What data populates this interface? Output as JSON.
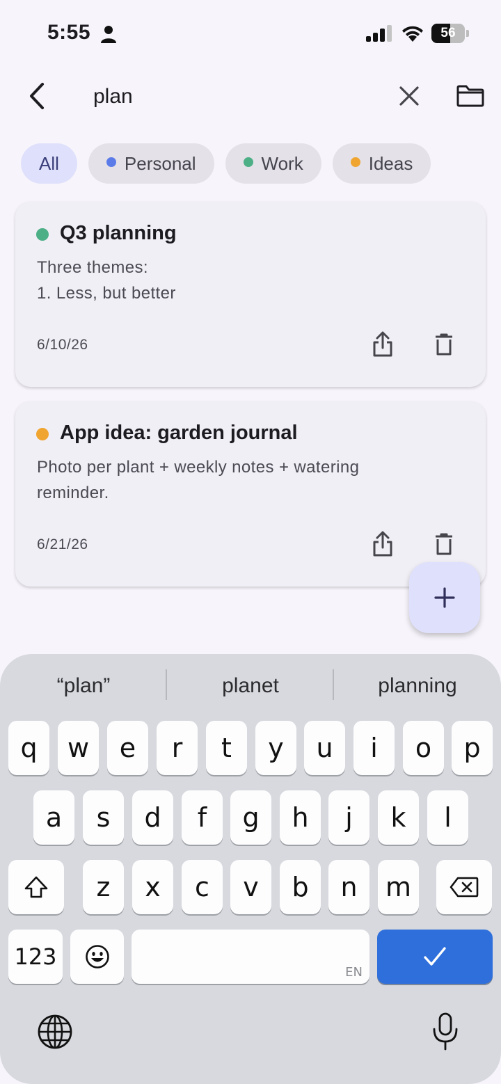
{
  "status_bar": {
    "time": "5:55",
    "battery_level": "56",
    "battery_fraction": 0.56
  },
  "search": {
    "query": "plan"
  },
  "filters": [
    {
      "label": "All",
      "selected": true,
      "dot_color": null
    },
    {
      "label": "Personal",
      "selected": false,
      "dot_color": "#5b7be8"
    },
    {
      "label": "Work",
      "selected": false,
      "dot_color": "#4caf86"
    },
    {
      "label": "Ideas",
      "selected": false,
      "dot_color": "#f0a531"
    }
  ],
  "notes": [
    {
      "title": "Q3 planning",
      "dot_color": "#4caf86",
      "body_lines": [
        "Three themes:",
        "1. Less, but better"
      ],
      "date": "6/10/26"
    },
    {
      "title": "App idea: garden journal",
      "dot_color": "#f0a531",
      "body_lines": [
        "Photo per plant + weekly notes + watering",
        "reminder."
      ],
      "date": "6/21/26"
    }
  ],
  "keyboard": {
    "suggestions": [
      "“plan”",
      "planet",
      "planning"
    ],
    "row1": [
      "q",
      "w",
      "e",
      "r",
      "t",
      "y",
      "u",
      "i",
      "o",
      "p"
    ],
    "row2": [
      "a",
      "s",
      "d",
      "f",
      "g",
      "h",
      "j",
      "k",
      "l"
    ],
    "row3": [
      "z",
      "x",
      "c",
      "v",
      "b",
      "n",
      "m"
    ],
    "numbers_label": "123",
    "space_language": "EN"
  },
  "colors": {
    "accent": "#2f6fdb",
    "selected_chip": "#dfe0fb",
    "background": "#f7f5fb"
  }
}
